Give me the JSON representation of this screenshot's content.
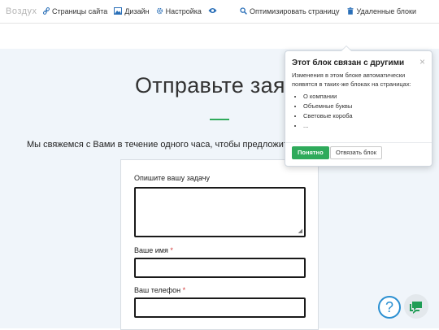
{
  "toolbar": {
    "logo": "Воздух",
    "items": [
      {
        "label": "Страницы сайта",
        "icon": "link-icon"
      },
      {
        "label": "Дизайн",
        "icon": "image-icon"
      },
      {
        "label": "Настройка",
        "icon": "gear-icon"
      },
      {
        "label": "",
        "icon": "eye-icon"
      }
    ],
    "right_items": [
      {
        "label": "Оптимизировать страницу",
        "icon": "search-icon"
      },
      {
        "label": "Удаленные блоки",
        "icon": "trash-icon"
      }
    ]
  },
  "main": {
    "title": "Отправьте заяв",
    "subtitle": "Мы свяжемся с Вами в течение одного часа, чтобы предложить лу",
    "accent_color": "#2faa5b"
  },
  "form": {
    "task_label": "Опишите вашу задачу",
    "name_label": "Ваше имя",
    "phone_label": "Ваш телефон",
    "required_mark": "*"
  },
  "popover": {
    "title": "Этот блок связан с другими",
    "close": "×",
    "text": "Изменения в этом блоке автоматически появятся в таких-же блоках на страницах:",
    "pages": [
      "О компании",
      "Объемные буквы",
      "Световые короба",
      "..."
    ],
    "ok_button": "Понятно",
    "unlink_button": "Отвязать блок"
  },
  "floating": {
    "help": "?",
    "chat_icon": "chat-icon"
  }
}
